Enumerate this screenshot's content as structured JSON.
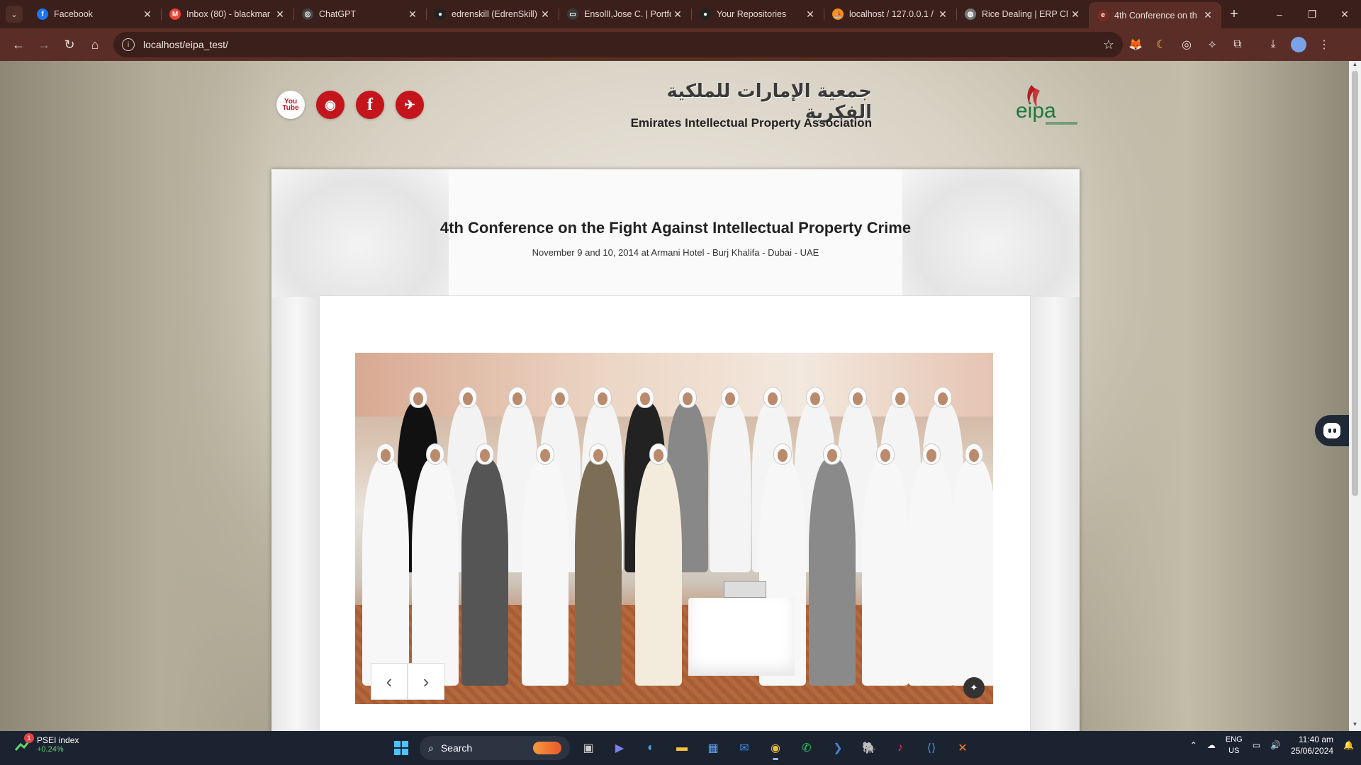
{
  "browser": {
    "tabs": [
      {
        "title": "Facebook",
        "icon": "facebook-icon",
        "color": "#1877f2",
        "glyph": "f"
      },
      {
        "title": "Inbox (80) - blackmar",
        "icon": "gmail-icon",
        "color": "#ea4335",
        "glyph": "M"
      },
      {
        "title": "ChatGPT",
        "icon": "chatgpt-icon",
        "color": "#444444",
        "glyph": "◎"
      },
      {
        "title": "edrenskill (EdrenSkill)",
        "icon": "github-icon",
        "color": "#222222",
        "glyph": "●"
      },
      {
        "title": "EnsollI,Jose C. | Portfo",
        "icon": "portfolio-icon",
        "color": "#3a3a3a",
        "glyph": "▭"
      },
      {
        "title": "Your Repositories",
        "icon": "github-icon",
        "color": "#222222",
        "glyph": "●"
      },
      {
        "title": "localhost / 127.0.0.1 /",
        "icon": "phpmyadmin-icon",
        "color": "#f29111",
        "glyph": "⛵"
      },
      {
        "title": "Rice Dealing | ERP Cl",
        "icon": "globe-icon",
        "color": "#777777",
        "glyph": "◍"
      },
      {
        "title": "4th Conference on th",
        "icon": "eipa-icon",
        "color": "#7a2a20",
        "glyph": "e"
      }
    ],
    "new_tab": "+",
    "window_controls": {
      "minimize": "–",
      "restore": "❐",
      "close": "✕"
    },
    "url": "localhost/eipa_test/"
  },
  "site": {
    "arabic_title": "جمعية الإمارات للملكية الفكرية",
    "english_title": "Emirates Intellectual Property Association",
    "social": [
      {
        "name": "youtube-icon",
        "label": "You Tube"
      },
      {
        "name": "rss-icon",
        "label": "◉"
      },
      {
        "name": "facebook-icon",
        "label": "f"
      },
      {
        "name": "twitter-icon",
        "label": "🐦"
      }
    ],
    "logo_text": "eipa"
  },
  "conference": {
    "title": "4th Conference on the Fight Against Intellectual Property Crime",
    "subtitle": "November 9 and 10, 2014 at Armani Hotel - Burj Khalifa - Dubai - UAE"
  },
  "slider": {
    "prev": "‹",
    "next": "›"
  },
  "taskbar": {
    "widget_title": "PSEI index",
    "widget_value": "+0.24%",
    "widget_badge": "1",
    "search_label": "Search",
    "lang_top": "ENG",
    "lang_bottom": "US",
    "time": "11:40 am",
    "date": "25/06/2024"
  }
}
